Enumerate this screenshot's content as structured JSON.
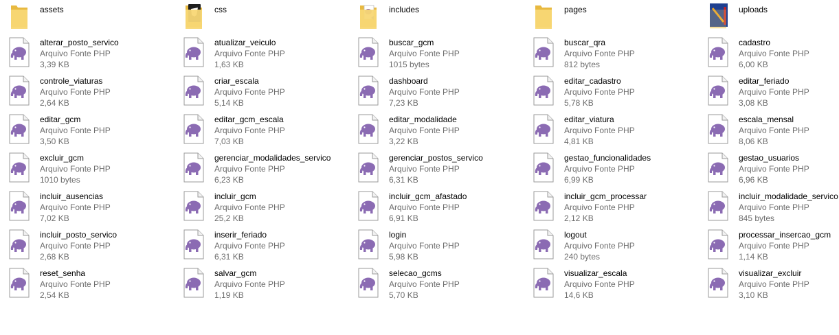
{
  "folders": [
    {
      "name": "assets",
      "icon": "folder-icon"
    },
    {
      "name": "css",
      "icon": "folder-css-icon"
    },
    {
      "name": "includes",
      "icon": "folder-includes-icon"
    },
    {
      "name": "pages",
      "icon": "folder-icon"
    },
    {
      "name": "uploads",
      "icon": "folder-uploads-icon"
    }
  ],
  "file_type_label": "Arquivo Fonte PHP",
  "files": [
    {
      "name": "alterar_posto_servico",
      "type": "Arquivo Fonte PHP",
      "size": "3,39 KB"
    },
    {
      "name": "atualizar_veiculo",
      "type": "Arquivo Fonte PHP",
      "size": "1,63 KB"
    },
    {
      "name": "buscar_gcm",
      "type": "Arquivo Fonte PHP",
      "size": "1015 bytes"
    },
    {
      "name": "buscar_qra",
      "type": "Arquivo Fonte PHP",
      "size": "812 bytes"
    },
    {
      "name": "cadastro",
      "type": "Arquivo Fonte PHP",
      "size": "6,00 KB"
    },
    {
      "name": "controle_viaturas",
      "type": "Arquivo Fonte PHP",
      "size": "2,64 KB"
    },
    {
      "name": "criar_escala",
      "type": "Arquivo Fonte PHP",
      "size": "5,14 KB"
    },
    {
      "name": "dashboard",
      "type": "Arquivo Fonte PHP",
      "size": "7,23 KB"
    },
    {
      "name": "editar_cadastro",
      "type": "Arquivo Fonte PHP",
      "size": "5,78 KB"
    },
    {
      "name": "editar_feriado",
      "type": "Arquivo Fonte PHP",
      "size": "3,08 KB"
    },
    {
      "name": "editar_gcm",
      "type": "Arquivo Fonte PHP",
      "size": "3,50 KB"
    },
    {
      "name": "editar_gcm_escala",
      "type": "Arquivo Fonte PHP",
      "size": "7,03 KB"
    },
    {
      "name": "editar_modalidade",
      "type": "Arquivo Fonte PHP",
      "size": "3,22 KB"
    },
    {
      "name": "editar_viatura",
      "type": "Arquivo Fonte PHP",
      "size": "4,81 KB"
    },
    {
      "name": "escala_mensal",
      "type": "Arquivo Fonte PHP",
      "size": "8,06 KB"
    },
    {
      "name": "excluir_gcm",
      "type": "Arquivo Fonte PHP",
      "size": "1010 bytes"
    },
    {
      "name": "gerenciar_modalidades_servico",
      "type": "Arquivo Fonte PHP",
      "size": "6,23 KB"
    },
    {
      "name": "gerenciar_postos_servico",
      "type": "Arquivo Fonte PHP",
      "size": "6,31 KB"
    },
    {
      "name": "gestao_funcionalidades",
      "type": "Arquivo Fonte PHP",
      "size": "6,99 KB"
    },
    {
      "name": "gestao_usuarios",
      "type": "Arquivo Fonte PHP",
      "size": "6,96 KB"
    },
    {
      "name": "incluir_ausencias",
      "type": "Arquivo Fonte PHP",
      "size": "7,02 KB"
    },
    {
      "name": "incluir_gcm",
      "type": "Arquivo Fonte PHP",
      "size": "25,2 KB"
    },
    {
      "name": "incluir_gcm_afastado",
      "type": "Arquivo Fonte PHP",
      "size": "6,91 KB"
    },
    {
      "name": "incluir_gcm_processar",
      "type": "Arquivo Fonte PHP",
      "size": "2,12 KB"
    },
    {
      "name": "incluir_modalidade_servico",
      "type": "Arquivo Fonte PHP",
      "size": "845 bytes"
    },
    {
      "name": "incluir_posto_servico",
      "type": "Arquivo Fonte PHP",
      "size": "2,68 KB"
    },
    {
      "name": "inserir_feriado",
      "type": "Arquivo Fonte PHP",
      "size": "6,31 KB"
    },
    {
      "name": "login",
      "type": "Arquivo Fonte PHP",
      "size": "5,98 KB"
    },
    {
      "name": "logout",
      "type": "Arquivo Fonte PHP",
      "size": "240 bytes"
    },
    {
      "name": "processar_insercao_gcm",
      "type": "Arquivo Fonte PHP",
      "size": "1,14 KB"
    },
    {
      "name": "reset_senha",
      "type": "Arquivo Fonte PHP",
      "size": "2,54 KB"
    },
    {
      "name": "salvar_gcm",
      "type": "Arquivo Fonte PHP",
      "size": "1,19 KB"
    },
    {
      "name": "selecao_gcms",
      "type": "Arquivo Fonte PHP",
      "size": "5,70 KB"
    },
    {
      "name": "visualizar_escala",
      "type": "Arquivo Fonte PHP",
      "size": "14,6 KB"
    },
    {
      "name": "visualizar_excluir",
      "type": "Arquivo Fonte PHP",
      "size": "3,10 KB"
    }
  ],
  "colors": {
    "folder": "#f8d775",
    "folder_dark": "#e8b940",
    "php_elephant": "#8b6bb3",
    "doc_border": "#9a9a9a",
    "text_secondary": "#6d6d6d"
  }
}
